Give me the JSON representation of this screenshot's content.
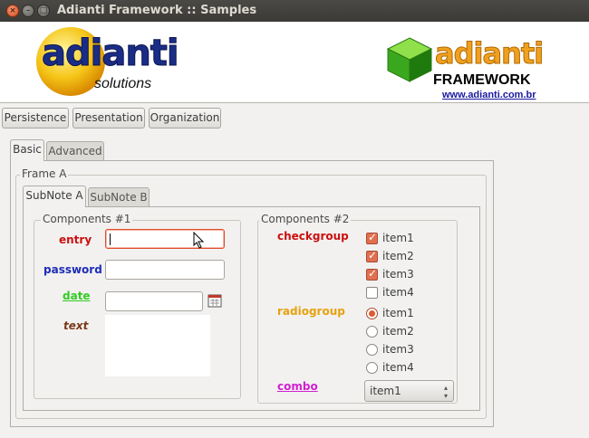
{
  "window": {
    "title": "Adianti Framework :: Samples"
  },
  "header": {
    "left_logo": {
      "brand": "adianti",
      "tagline": "solutions"
    },
    "right_logo": {
      "brand": "adianti",
      "product": "FRAMEWORK",
      "url": "www.adianti.com.br"
    }
  },
  "menu": {
    "items": [
      {
        "label": "Persistence"
      },
      {
        "label": "Presentation"
      },
      {
        "label": "Organization"
      }
    ]
  },
  "tabs": [
    {
      "label": "Basic"
    },
    {
      "label": "Advanced"
    }
  ],
  "frame": {
    "label": "Frame A"
  },
  "subtabs": [
    {
      "label": "SubNote A"
    },
    {
      "label": "SubNote B"
    }
  ],
  "components1": {
    "label": "Components #1",
    "fields": [
      {
        "label": "entry",
        "color": "#cc1010"
      },
      {
        "label": "password",
        "color": "#1e2db8"
      },
      {
        "label": "date",
        "color": "#33cc22"
      },
      {
        "label": "text",
        "color": "#7a3a1a"
      }
    ]
  },
  "components2": {
    "label": "Components #2",
    "checkgroup": {
      "label": "checkgroup",
      "color": "#cc1010",
      "items": [
        {
          "label": "item1",
          "checked": true
        },
        {
          "label": "item2",
          "checked": true
        },
        {
          "label": "item3",
          "checked": true
        },
        {
          "label": "item4",
          "checked": false
        }
      ]
    },
    "radiogroup": {
      "label": "radiogroup",
      "color": "#e6a210",
      "items": [
        {
          "label": "item1",
          "selected": true
        },
        {
          "label": "item2",
          "selected": false
        },
        {
          "label": "item3",
          "selected": false
        },
        {
          "label": "item4",
          "selected": false
        }
      ]
    },
    "combo": {
      "label": "combo",
      "color": "#d020d0",
      "value": "item1"
    }
  },
  "icons": {
    "window_close": "close-icon",
    "window_minimize": "minimize-icon",
    "window_maximize": "maximize-icon",
    "calendar": "calendar-icon",
    "mouse_pointer": "cursor-icon"
  }
}
